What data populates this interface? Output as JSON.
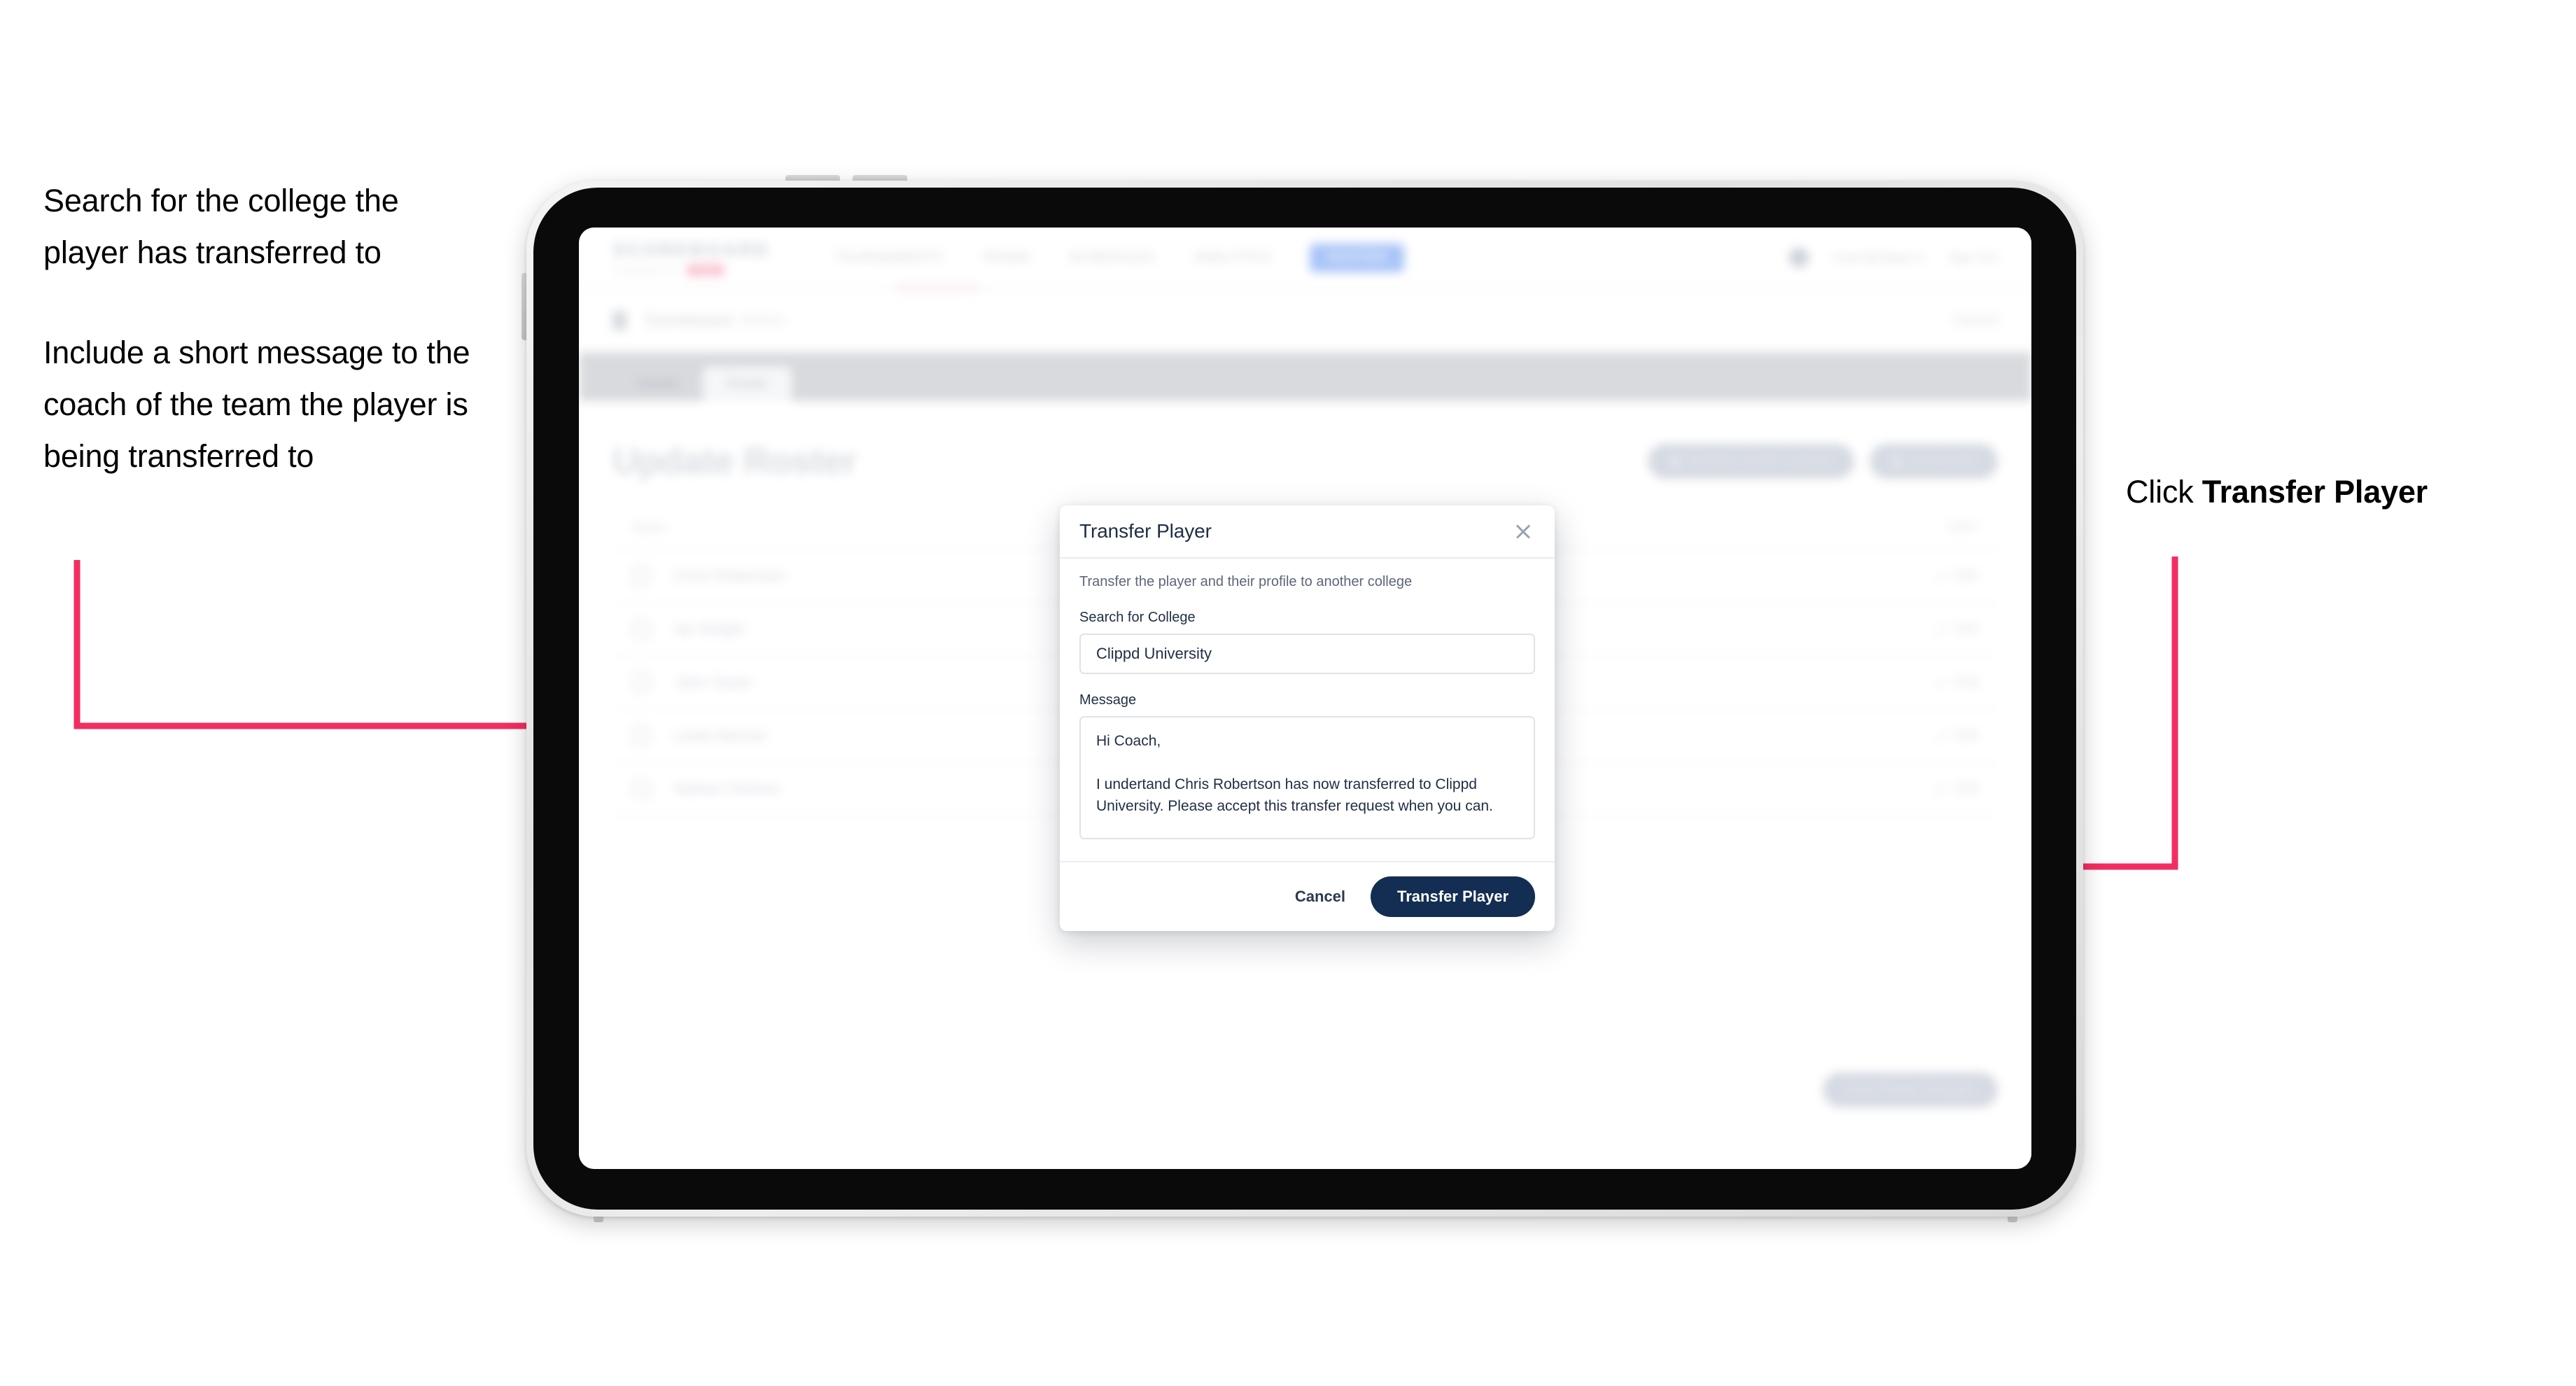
{
  "annotations": {
    "left_1": "Search for the college the player has transferred to",
    "left_2": "Include a short message to the coach of the team the player is being transferred to",
    "right_prefix": "Click ",
    "right_strong": "Transfer Player"
  },
  "colors": {
    "arrow_pink": "#F22D62",
    "primary_navy": "#132E52",
    "modal_text": "#1F2E44",
    "muted_text": "#5C6778",
    "border": "#DFE3E9"
  },
  "app": {
    "logo": "SCOREBOARD",
    "logo_sub": "POWERED BY",
    "logo_badge": "clippd",
    "nav_items": [
      "TOURNAMENTS",
      "TEAMS",
      "SCHEDULES",
      "ANALYTICS"
    ],
    "nav_pill": "ROSTER",
    "user_name": "coach@clippd.io",
    "sign_out": "Sign Out",
    "subheader": {
      "title": "Scoreboard",
      "title_light": "Admin",
      "right_action": "Cancel"
    },
    "tabs": [
      {
        "label": "Details",
        "active": false
      },
      {
        "label": "Roster",
        "active": true
      }
    ],
    "page_title": "Update Roster",
    "page_actions": [
      "Request Player Transfer",
      "Add Player"
    ],
    "table": {
      "columns": [
        "Name",
        "EDIT"
      ],
      "rows": [
        {
          "name": "Chris Robertson",
          "edit": "Edit"
        },
        {
          "name": "Ian Wright",
          "edit": "Edit"
        },
        {
          "name": "John Taylor",
          "edit": "Edit"
        },
        {
          "name": "Lewis Banner",
          "edit": "Edit"
        },
        {
          "name": "Nathan Holmes",
          "edit": "Edit"
        }
      ]
    },
    "footer_button": "Save Roster Changes"
  },
  "modal": {
    "title": "Transfer Player",
    "close_icon": "close-icon",
    "subtitle": "Transfer the player and their profile to another college",
    "college_label": "Search for College",
    "college_value": "Clippd University",
    "college_placeholder": "Search for College",
    "message_label": "Message",
    "message_value": "Hi Coach,\n\nI undertand Chris Robertson has now transferred to Clippd University. Please accept this transfer request when you can.",
    "message_placeholder": "Message",
    "cancel_label": "Cancel",
    "submit_label": "Transfer Player"
  }
}
